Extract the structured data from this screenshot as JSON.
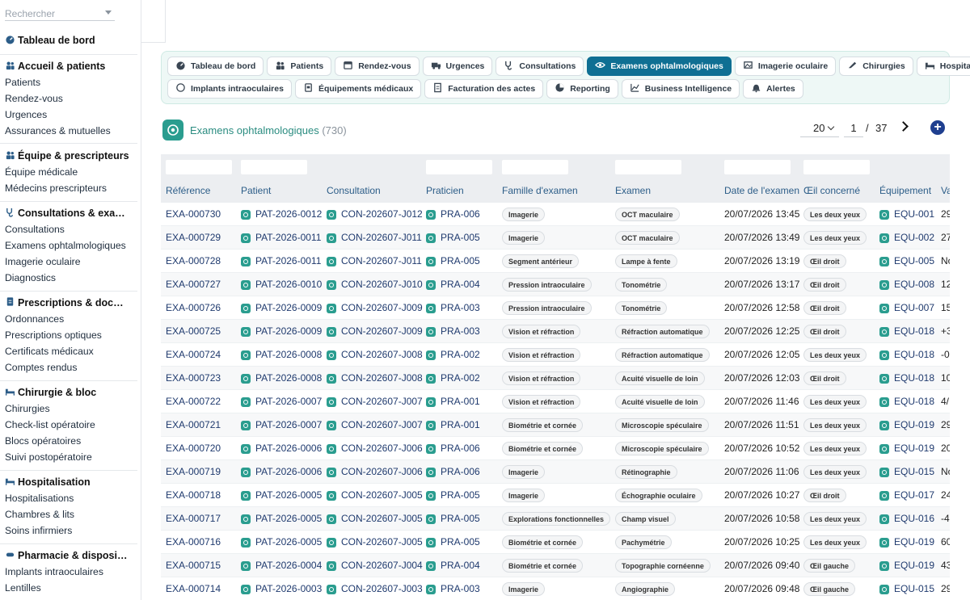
{
  "sidebar": {
    "search_placeholder": "Rechercher",
    "dashboard": "Tableau de bord",
    "sections": [
      {
        "title": "Accueil & patients",
        "items": [
          "Patients",
          "Rendez-vous",
          "Urgences",
          "Assurances & mutuelles"
        ]
      },
      {
        "title": "Équipe & prescripteurs",
        "items": [
          "Équipe médicale",
          "Médecins prescripteurs"
        ]
      },
      {
        "title": "Consultations & exa…",
        "items": [
          "Consultations",
          "Examens ophtalmologiques",
          "Imagerie oculaire",
          "Diagnostics"
        ]
      },
      {
        "title": "Prescriptions & doc…",
        "items": [
          "Ordonnances",
          "Prescriptions optiques",
          "Certificats médicaux",
          "Comptes rendus"
        ]
      },
      {
        "title": "Chirurgie & bloc",
        "items": [
          "Chirurgies",
          "Check-list opératoire",
          "Blocs opératoires",
          "Suivi postopératoire"
        ]
      },
      {
        "title": "Hospitalisation",
        "items": [
          "Hospitalisations",
          "Chambres & lits",
          "Soins infirmiers"
        ]
      },
      {
        "title": "Pharmacie & disposi…",
        "items": [
          "Implants intraoculaires",
          "Lentilles"
        ]
      }
    ]
  },
  "nav": {
    "row1": [
      "Tableau de bord",
      "Patients",
      "Rendez-vous",
      "Urgences",
      "Consultations",
      "Examens ophtalmologiques",
      "Imagerie oculaire",
      "Chirurgies",
      "Hospitalisations"
    ],
    "row2": [
      "Implants intraoculaires",
      "Équipements médicaux",
      "Facturation des actes",
      "Reporting",
      "Business Intelligence",
      "Alertes"
    ],
    "active": "Examens ophtalmologiques"
  },
  "page": {
    "title": "Examens ophtalmologiques",
    "count": "(730)",
    "per_page": "20",
    "current_page": "1",
    "page_sep": "/",
    "total_pages": "37",
    "add_label": "+"
  },
  "table": {
    "columns": [
      "Référence",
      "Patient",
      "Consultation",
      "Praticien",
      "Famille d'examen",
      "Examen",
      "Date de l'examen",
      "Œil concerné",
      "Équipement",
      "Va"
    ],
    "rows": [
      {
        "ref": "EXA-000730",
        "patient": "PAT-2026-0012",
        "consultation": "CON-202607-J012",
        "praticien": "PRA-006",
        "famille": "Imagerie",
        "examen": "OCT maculaire",
        "date": "20/07/2026 13:45",
        "oeil": "Les deux yeux",
        "equipement": "EQU-001",
        "valeur": "29"
      },
      {
        "ref": "EXA-000729",
        "patient": "PAT-2026-0011",
        "consultation": "CON-202607-J011",
        "praticien": "PRA-005",
        "famille": "Imagerie",
        "examen": "OCT maculaire",
        "date": "20/07/2026 13:49",
        "oeil": "Les deux yeux",
        "equipement": "EQU-002",
        "valeur": "27"
      },
      {
        "ref": "EXA-000728",
        "patient": "PAT-2026-0011",
        "consultation": "CON-202607-J011",
        "praticien": "PRA-005",
        "famille": "Segment antérieur",
        "examen": "Lampe à fente",
        "date": "20/07/2026 13:19",
        "oeil": "Œil droit",
        "equipement": "EQU-005",
        "valeur": "No"
      },
      {
        "ref": "EXA-000727",
        "patient": "PAT-2026-0010",
        "consultation": "CON-202607-J010",
        "praticien": "PRA-004",
        "famille": "Pression intraoculaire",
        "examen": "Tonométrie",
        "date": "20/07/2026 13:17",
        "oeil": "Œil droit",
        "equipement": "EQU-008",
        "valeur": "12"
      },
      {
        "ref": "EXA-000726",
        "patient": "PAT-2026-0009",
        "consultation": "CON-202607-J009",
        "praticien": "PRA-003",
        "famille": "Pression intraoculaire",
        "examen": "Tonométrie",
        "date": "20/07/2026 12:58",
        "oeil": "Œil droit",
        "equipement": "EQU-007",
        "valeur": "15"
      },
      {
        "ref": "EXA-000725",
        "patient": "PAT-2026-0009",
        "consultation": "CON-202607-J009",
        "praticien": "PRA-003",
        "famille": "Vision et réfraction",
        "examen": "Réfraction automatique",
        "date": "20/07/2026 12:25",
        "oeil": "Œil droit",
        "equipement": "EQU-018",
        "valeur": "+3"
      },
      {
        "ref": "EXA-000724",
        "patient": "PAT-2026-0008",
        "consultation": "CON-202607-J008",
        "praticien": "PRA-002",
        "famille": "Vision et réfraction",
        "examen": "Réfraction automatique",
        "date": "20/07/2026 12:05",
        "oeil": "Les deux yeux",
        "equipement": "EQU-018",
        "valeur": "-0"
      },
      {
        "ref": "EXA-000723",
        "patient": "PAT-2026-0008",
        "consultation": "CON-202607-J008",
        "praticien": "PRA-002",
        "famille": "Vision et réfraction",
        "examen": "Acuité visuelle de loin",
        "date": "20/07/2026 12:03",
        "oeil": "Œil droit",
        "equipement": "EQU-018",
        "valeur": "10"
      },
      {
        "ref": "EXA-000722",
        "patient": "PAT-2026-0007",
        "consultation": "CON-202607-J007",
        "praticien": "PRA-001",
        "famille": "Vision et réfraction",
        "examen": "Acuité visuelle de loin",
        "date": "20/07/2026 11:46",
        "oeil": "Les deux yeux",
        "equipement": "EQU-018",
        "valeur": "4/"
      },
      {
        "ref": "EXA-000721",
        "patient": "PAT-2026-0007",
        "consultation": "CON-202607-J007",
        "praticien": "PRA-001",
        "famille": "Biométrie et cornée",
        "examen": "Microscopie spéculaire",
        "date": "20/07/2026 11:51",
        "oeil": "Les deux yeux",
        "equipement": "EQU-019",
        "valeur": "29"
      },
      {
        "ref": "EXA-000720",
        "patient": "PAT-2026-0006",
        "consultation": "CON-202607-J006",
        "praticien": "PRA-006",
        "famille": "Biométrie et cornée",
        "examen": "Microscopie spéculaire",
        "date": "20/07/2026 10:52",
        "oeil": "Les deux yeux",
        "equipement": "EQU-019",
        "valeur": "20"
      },
      {
        "ref": "EXA-000719",
        "patient": "PAT-2026-0006",
        "consultation": "CON-202607-J006",
        "praticien": "PRA-006",
        "famille": "Imagerie",
        "examen": "Rétinographie",
        "date": "20/07/2026 11:06",
        "oeil": "Les deux yeux",
        "equipement": "EQU-015",
        "valeur": "No"
      },
      {
        "ref": "EXA-000718",
        "patient": "PAT-2026-0005",
        "consultation": "CON-202607-J005",
        "praticien": "PRA-005",
        "famille": "Imagerie",
        "examen": "Échographie oculaire",
        "date": "20/07/2026 10:27",
        "oeil": "Œil droit",
        "equipement": "EQU-017",
        "valeur": "24"
      },
      {
        "ref": "EXA-000717",
        "patient": "PAT-2026-0005",
        "consultation": "CON-202607-J005",
        "praticien": "PRA-005",
        "famille": "Explorations fonctionnelles",
        "examen": "Champ visuel",
        "date": "20/07/2026 10:58",
        "oeil": "Les deux yeux",
        "equipement": "EQU-016",
        "valeur": "-4"
      },
      {
        "ref": "EXA-000716",
        "patient": "PAT-2026-0005",
        "consultation": "CON-202607-J005",
        "praticien": "PRA-005",
        "famille": "Biométrie et cornée",
        "examen": "Pachymétrie",
        "date": "20/07/2026 10:25",
        "oeil": "Les deux yeux",
        "equipement": "EQU-019",
        "valeur": "60"
      },
      {
        "ref": "EXA-000715",
        "patient": "PAT-2026-0004",
        "consultation": "CON-202607-J004",
        "praticien": "PRA-004",
        "famille": "Biométrie et cornée",
        "examen": "Topographie cornéenne",
        "date": "20/07/2026 09:40",
        "oeil": "Œil gauche",
        "equipement": "EQU-019",
        "valeur": "43"
      },
      {
        "ref": "EXA-000714",
        "patient": "PAT-2026-0003",
        "consultation": "CON-202607-J003",
        "praticien": "PRA-003",
        "famille": "Imagerie",
        "examen": "Angiographie",
        "date": "20/07/2026 09:48",
        "oeil": "Œil gauche",
        "equipement": "EQU-015",
        "valeur": "29"
      }
    ]
  },
  "colors": {
    "accent": "#0f6f93",
    "teal": "#2a9d8f",
    "nav_bg": "#eef8f6",
    "link": "#1f3a6e"
  }
}
